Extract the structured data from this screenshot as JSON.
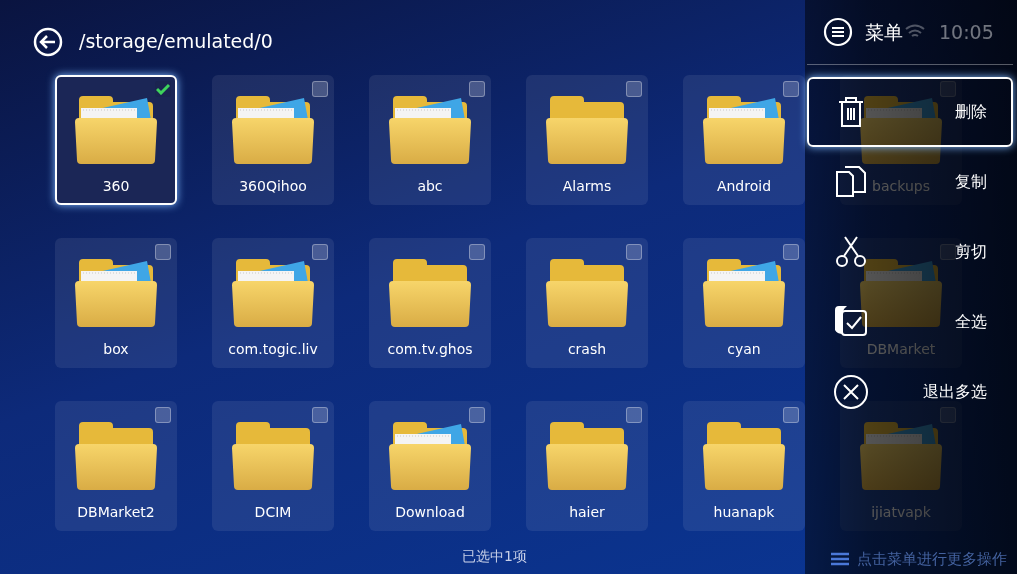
{
  "header": {
    "path": "/storage/emulated/0"
  },
  "status": {
    "time": "10:05"
  },
  "folders": [
    {
      "name": "360",
      "kind": "open",
      "checked": true,
      "selected": true
    },
    {
      "name": "360Qihoo",
      "kind": "open",
      "checked": false,
      "selected": false
    },
    {
      "name": "abc",
      "kind": "open",
      "checked": false,
      "selected": false
    },
    {
      "name": "Alarms",
      "kind": "plain",
      "checked": false,
      "selected": false
    },
    {
      "name": "Android",
      "kind": "open",
      "checked": false,
      "selected": false
    },
    {
      "name": "backups",
      "kind": "open",
      "checked": false,
      "selected": false
    },
    {
      "name": "box",
      "kind": "open",
      "checked": false,
      "selected": false
    },
    {
      "name": "com.togic.liv",
      "kind": "open",
      "checked": false,
      "selected": false
    },
    {
      "name": "com.tv.ghos",
      "kind": "plain",
      "checked": false,
      "selected": false
    },
    {
      "name": "crash",
      "kind": "plain",
      "checked": false,
      "selected": false
    },
    {
      "name": "cyan",
      "kind": "open",
      "checked": false,
      "selected": false
    },
    {
      "name": "DBMarket",
      "kind": "open",
      "checked": false,
      "selected": false
    },
    {
      "name": "DBMarket2",
      "kind": "plain",
      "checked": false,
      "selected": false
    },
    {
      "name": "DCIM",
      "kind": "plain",
      "checked": false,
      "selected": false
    },
    {
      "name": "Download",
      "kind": "open",
      "checked": false,
      "selected": false
    },
    {
      "name": "haier",
      "kind": "plain",
      "checked": false,
      "selected": false
    },
    {
      "name": "huanapk",
      "kind": "plain",
      "checked": false,
      "selected": false
    },
    {
      "name": "ijiatvapk",
      "kind": "open",
      "checked": false,
      "selected": false
    }
  ],
  "footer": {
    "selection_count": "已选中1项",
    "hint": "点击菜单进行更多操作"
  },
  "menu": {
    "title": "菜单",
    "items": [
      {
        "kind": "delete",
        "label": "删除",
        "selected": true
      },
      {
        "kind": "copy",
        "label": "复制",
        "selected": false
      },
      {
        "kind": "cut",
        "label": "剪切",
        "selected": false
      },
      {
        "kind": "select_all",
        "label": "全选",
        "selected": false
      },
      {
        "kind": "exit",
        "label": "退出多选",
        "selected": false
      }
    ]
  }
}
